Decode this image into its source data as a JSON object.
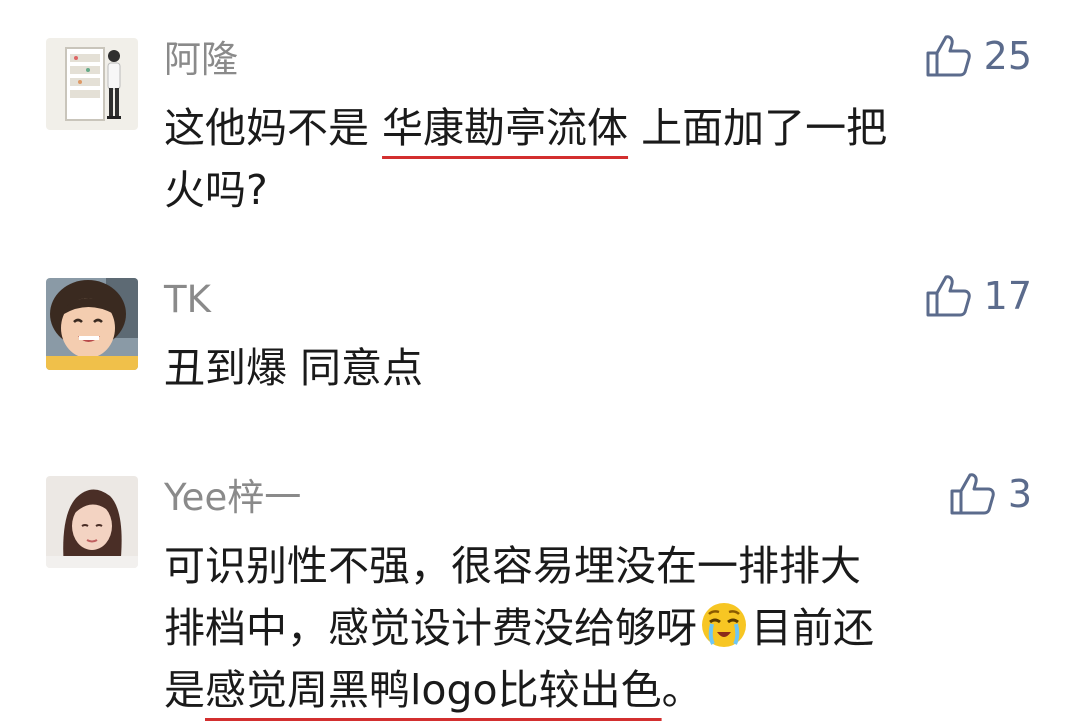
{
  "comments": [
    {
      "author": "阿隆",
      "likes": "25",
      "avatar_icon": "vending-machine-person-avatar",
      "lines": [
        {
          "before": "这他妈不是 ",
          "underlined": "华康勘亭流体",
          "after": " 上面加了一把"
        },
        {
          "text": "火吗?"
        }
      ]
    },
    {
      "author": "TK",
      "likes": "17",
      "avatar_icon": "smiling-child-avatar",
      "lines": [
        {
          "text": "丑到爆 同意点"
        }
      ]
    },
    {
      "author": "Yee梓一",
      "likes": "3",
      "avatar_icon": "woman-portrait-avatar",
      "lines": [
        {
          "text": "可识别性不强，很容易埋没在一排排大"
        },
        {
          "before": "排档中，感觉设计费没给够呀",
          "emoji": "crying-face-emoji",
          "after": "目前还"
        },
        {
          "before": "是",
          "underlined": "感觉周黑鸭logo比较出色",
          "after": "。"
        }
      ]
    }
  ],
  "colors": {
    "username": "#8a8a8a",
    "like": "#5b6b8c",
    "text": "#1a1a1a",
    "underline": "#d32f2f"
  },
  "like_icon": "thumbs-up-icon"
}
